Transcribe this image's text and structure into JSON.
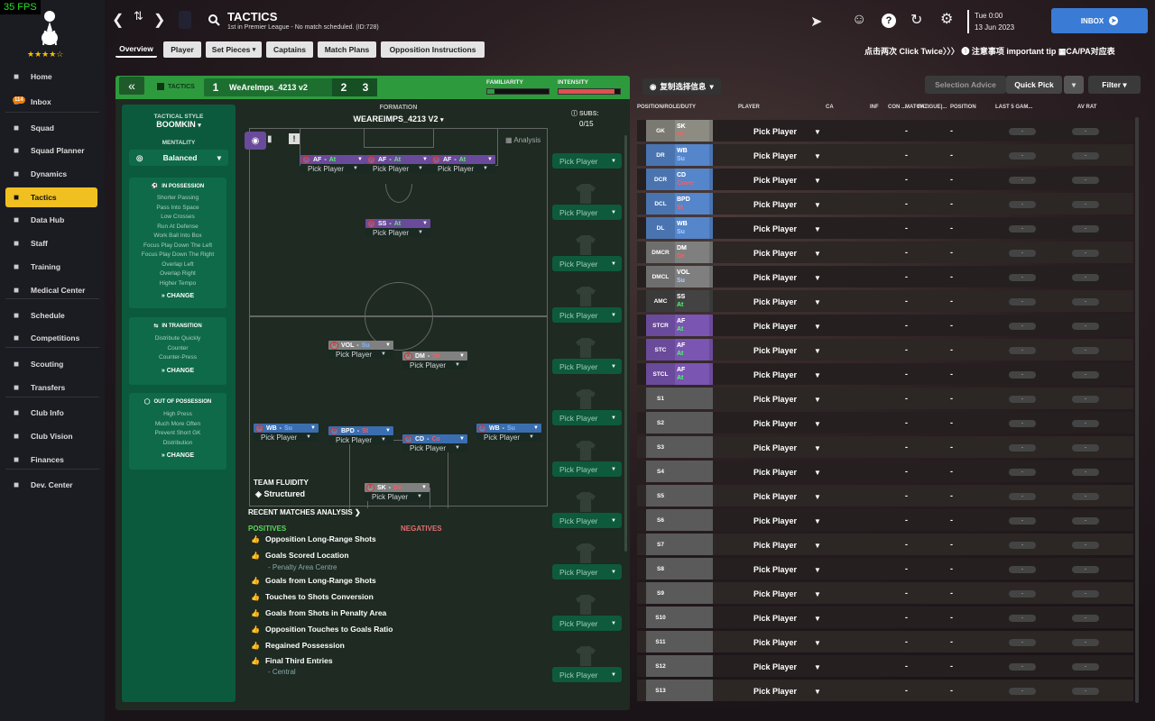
{
  "app": {
    "fps": "35 FPS",
    "rating_stars": "★★★★☆"
  },
  "sidebar": {
    "items": [
      {
        "label": "Home",
        "icon": "home-icon"
      },
      {
        "label": "Inbox",
        "icon": "inbox-icon",
        "badge": "114"
      },
      {
        "label": "Squad",
        "icon": "squad-icon"
      },
      {
        "label": "Squad Planner",
        "icon": "squad-planner-icon"
      },
      {
        "label": "Dynamics",
        "icon": "dynamics-icon"
      },
      {
        "label": "Tactics",
        "icon": "tactics-icon",
        "active": true
      },
      {
        "label": "Data Hub",
        "icon": "data-hub-icon"
      },
      {
        "label": "Staff",
        "icon": "staff-icon"
      },
      {
        "label": "Training",
        "icon": "training-icon"
      },
      {
        "label": "Medical Center",
        "icon": "medical-icon"
      },
      {
        "label": "Schedule",
        "icon": "schedule-icon"
      },
      {
        "label": "Competitions",
        "icon": "trophy-icon"
      },
      {
        "label": "Scouting",
        "icon": "scouting-icon"
      },
      {
        "label": "Transfers",
        "icon": "transfers-icon"
      },
      {
        "label": "Club Info",
        "icon": "club-info-icon"
      },
      {
        "label": "Club Vision",
        "icon": "club-vision-icon"
      },
      {
        "label": "Finances",
        "icon": "finances-icon"
      },
      {
        "label": "Dev. Center",
        "icon": "dev-center-icon"
      }
    ]
  },
  "header": {
    "title": "TACTICS",
    "subtitle": "1st in Premier League - No match scheduled. (ID:728)",
    "day": "Tue 0:00",
    "date": "13 Jun 2023",
    "inbox_label": "INBOX"
  },
  "tabs": [
    "Overview",
    "Player",
    "Set Pieces",
    "Captains",
    "Match Plans",
    "Opposition Instructions"
  ],
  "tip": "点击两次 Click Twice〉〉〉 ❶ 注意事项 important tip ▦CA/PA对应表",
  "tactic": {
    "label": "TACTICS",
    "slot1": "1",
    "name": "WeAreImps_4213 v2",
    "slot2": "2",
    "slot3": "3",
    "familiarity": "FAMILIARITY",
    "intensity": "INTENSITY",
    "formation_label": "FORMATION",
    "formation_name": "WEAREIMPS_4213 V2",
    "subs_label": "SUBS:",
    "subs_count": "0/15",
    "analysis": "Analysis",
    "team_fluidity_label": "TEAM FLUIDITY",
    "team_fluidity": "Structured"
  },
  "style": {
    "label": "TACTICAL STYLE",
    "name": "BOOMKIN",
    "mentality_label": "MENTALITY",
    "mentality": "Balanced",
    "in_possession": {
      "title": "IN POSSESSION",
      "items": [
        "Shorter Passing",
        "Pass Into Space",
        "Low Crosses",
        "Run At Defense",
        "Work Ball Into Box",
        "Focus Play Down The Left",
        "Focus Play Down The Right",
        "Overlap Left",
        "Overlap Right",
        "Higher Tempo"
      ]
    },
    "in_transition": {
      "title": "IN TRANSITION",
      "items": [
        "Distribute Quickly",
        "Counter",
        "Counter-Press"
      ]
    },
    "out_possession": {
      "title": "OUT OF POSSESSION",
      "items": [
        "High Press",
        "Much More Often",
        "Prevent Short GK",
        "Distribution"
      ]
    },
    "change": "CHANGE"
  },
  "players": [
    {
      "role": "AF",
      "duty": "At",
      "cls": "at"
    },
    {
      "role": "AF",
      "duty": "At",
      "cls": "at"
    },
    {
      "role": "AF",
      "duty": "At",
      "cls": "at"
    },
    {
      "role": "SS",
      "duty": "At",
      "cls": "at"
    },
    {
      "role": "VOL",
      "duty": "Su",
      "cls": "de"
    },
    {
      "role": "DM",
      "duty": "De",
      "cls": "de"
    },
    {
      "role": "WB",
      "duty": "Su",
      "cls": "su"
    },
    {
      "role": "BPD",
      "duty": "St",
      "cls": "su"
    },
    {
      "role": "CD",
      "duty": "Co",
      "cls": "su"
    },
    {
      "role": "WB",
      "duty": "Su",
      "cls": "su"
    },
    {
      "role": "SK",
      "duty": "De",
      "cls": "de"
    }
  ],
  "pick_player": "Pick Player",
  "analysis": {
    "title": "RECENT MATCHES ANALYSIS",
    "positives": "POSITIVES",
    "negatives": "NEGATIVES",
    "items": [
      "Opposition Long-Range Shots",
      "Goals Scored Location",
      "Goals from Long-Range Shots",
      "Touches to Shots Conversion",
      "Goals from Shots in Penalty Area",
      "Opposition Touches to Goals Ratio",
      "Regained Possession",
      "Final Third Entries"
    ],
    "sub1": "- Penalty Area Centre",
    "sub2": "- Central"
  },
  "right": {
    "view_label": "复制选择信息",
    "selection_advice": "Selection Advice",
    "quick_pick": "Quick Pick",
    "filter": "Filter",
    "columns": [
      "POSITION/ROLE/DUTY",
      "PLAYER",
      "CA",
      "INF",
      "CON ...",
      "MATCH...",
      "FATIGUE|...",
      "POSITION",
      "LAST 5 GAM...",
      "AV RAT"
    ],
    "rows": [
      {
        "pos": "GK",
        "role": "SK",
        "duty": "De",
        "color": "#7a7a72",
        "dc": "#e05050"
      },
      {
        "pos": "DR",
        "role": "WB",
        "duty": "Su",
        "color": "#4a74b0",
        "dc": "#8fb8ff"
      },
      {
        "pos": "DCR",
        "role": "CD",
        "duty": "Cover",
        "color": "#4a74b0",
        "dc": "#e05050"
      },
      {
        "pos": "DCL",
        "role": "BPD",
        "duty": "St",
        "color": "#4a74b0",
        "dc": "#e05050"
      },
      {
        "pos": "DL",
        "role": "WB",
        "duty": "Su",
        "color": "#4a74b0",
        "dc": "#8fb8ff"
      },
      {
        "pos": "DMCR",
        "role": "DM",
        "duty": "De",
        "color": "#6e6e6e",
        "dc": "#e05050"
      },
      {
        "pos": "DMCL",
        "role": "VOL",
        "duty": "Su",
        "color": "#6e6e6e",
        "dc": "#8fb8ff"
      },
      {
        "pos": "AMC",
        "role": "SS",
        "duty": "At",
        "color": "#3a3a3a",
        "dc": "#40e060"
      },
      {
        "pos": "STCR",
        "role": "AF",
        "duty": "At",
        "color": "#6a4a9a",
        "dc": "#40e060"
      },
      {
        "pos": "STC",
        "role": "AF",
        "duty": "At",
        "color": "#6a4a9a",
        "dc": "#40e060"
      },
      {
        "pos": "STCL",
        "role": "AF",
        "duty": "At",
        "color": "#6a4a9a",
        "dc": "#40e060"
      },
      {
        "pos": "S1"
      },
      {
        "pos": "S2"
      },
      {
        "pos": "S3"
      },
      {
        "pos": "S4"
      },
      {
        "pos": "S5"
      },
      {
        "pos": "S6"
      },
      {
        "pos": "S7"
      },
      {
        "pos": "S8"
      },
      {
        "pos": "S9"
      },
      {
        "pos": "S10"
      },
      {
        "pos": "S11"
      },
      {
        "pos": "S12"
      },
      {
        "pos": "S13"
      }
    ],
    "dash": "-"
  }
}
